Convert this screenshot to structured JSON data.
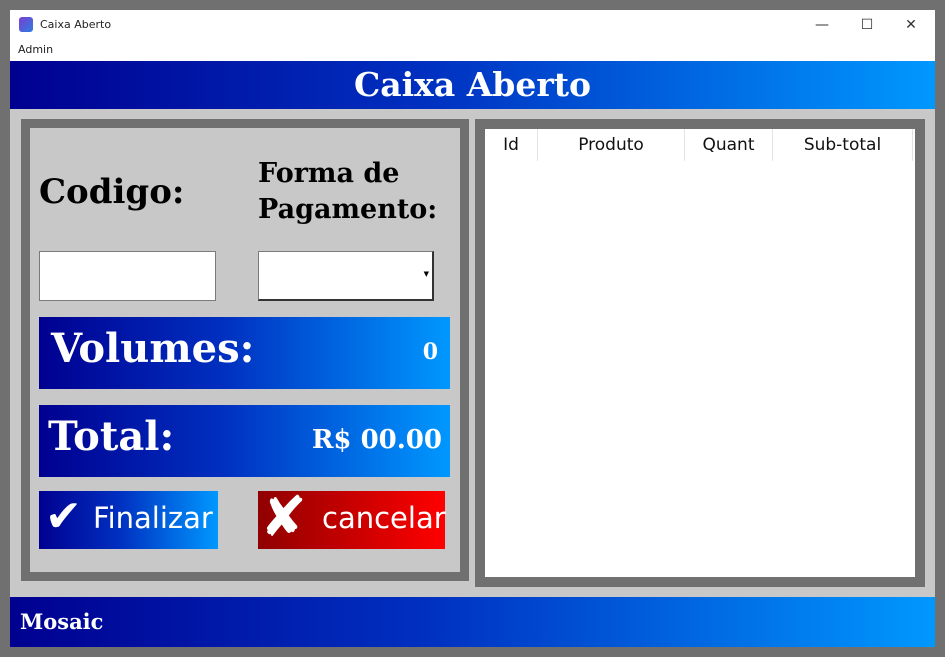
{
  "window": {
    "title": "Caixa Aberto",
    "minimize": "—",
    "maximize": "☐",
    "close": "✕"
  },
  "menu": {
    "items": [
      "Admin"
    ]
  },
  "header": {
    "title": "Caixa Aberto"
  },
  "form": {
    "codigo_label": "Codigo:",
    "pagamento_label_1": "Forma de",
    "pagamento_label_2": "Pagamento:",
    "codigo_value": "",
    "pagamento_value": ""
  },
  "volumes": {
    "label": "Volumes:",
    "value": "0"
  },
  "total": {
    "label": "Total:",
    "value": "R$ 00.00"
  },
  "buttons": {
    "finalizar": "Finalizar",
    "cancelar": "cancelar"
  },
  "table": {
    "columns": [
      "Id",
      "Produto",
      "Quant",
      "Sub-total"
    ],
    "rows": []
  },
  "footer": {
    "text": "Mosaic"
  },
  "colors": {
    "accent_dark": "#000090",
    "accent_light": "#0098ff",
    "cancel_dark": "#900000",
    "cancel_light": "#ff0000"
  }
}
